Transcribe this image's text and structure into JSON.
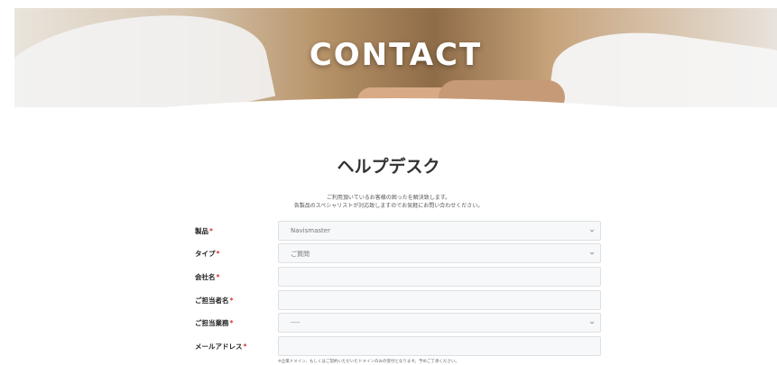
{
  "hero": {
    "title": "CONTACT"
  },
  "section": {
    "heading": "ヘルプデスク",
    "intro_line1": "ご利用頂いているお客様の困ったを解決致します。",
    "intro_line2": "各製品のスペシャリストが対応致しますのでお気軽にお問い合わせください。"
  },
  "form": {
    "required_mark": "*",
    "product": {
      "label": "製品",
      "value": "Navismaster"
    },
    "type": {
      "label": "タイプ",
      "value": "ご質問"
    },
    "company": {
      "label": "会社名",
      "value": ""
    },
    "person": {
      "label": "ご担当者名",
      "value": ""
    },
    "duty": {
      "label": "ご担当業務",
      "value": "----"
    },
    "email": {
      "label": "メールアドレス",
      "value": ""
    },
    "email_note": "※企業ドメイン、もしくはご契約いただいたドメインのみの受付となります。予めご了承ください。"
  },
  "icons": {
    "select_chevron": "chevron-down-icon"
  }
}
